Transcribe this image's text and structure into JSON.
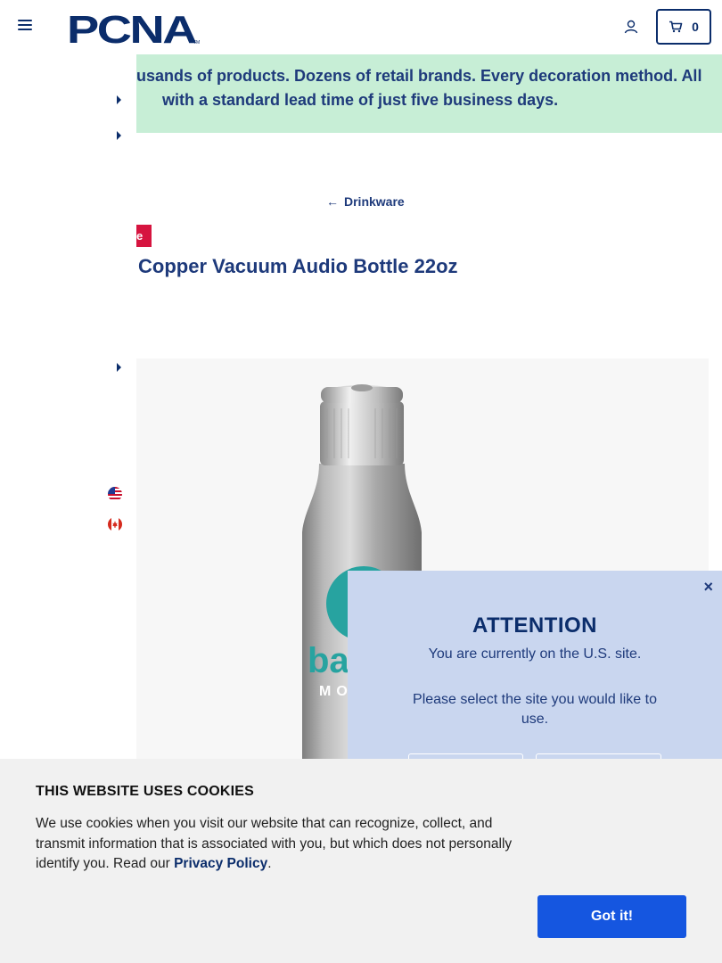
{
  "header": {
    "logo_text": "PCNA",
    "cart_count": "0"
  },
  "banner": {
    "line1": "usands of products. Dozens of retail brands. Every decoration method. All",
    "line2": "with a standard lead time of just five business days."
  },
  "breadcrumb": {
    "arrow": "←",
    "label": "Drinkware"
  },
  "product": {
    "sale_tag": "e",
    "title": "Copper Vacuum Audio Bottle 22oz",
    "image_alt": "Silver stainless bottle with teal logo"
  },
  "attention_modal": {
    "close": "×",
    "title": "ATTENTION",
    "line1": "You are currently on the U.S. site.",
    "line2": "Please select the site you would like to use."
  },
  "cookie_banner": {
    "title": "THIS WEBSITE USES COOKIES",
    "text_before": "We use cookies when you visit our website that can recognize, collect, and transmit information that is associated with you, but which does not personally identify you. Read our ",
    "link": "Privacy Policy",
    "text_after": ".",
    "button": "Got it!"
  },
  "colors": {
    "brand_navy": "#0b2d6b",
    "banner_bg": "#c7eed6",
    "sale_red": "#d6143f",
    "modal_bg": "#c9d6ef",
    "button_blue": "#1556e0"
  }
}
